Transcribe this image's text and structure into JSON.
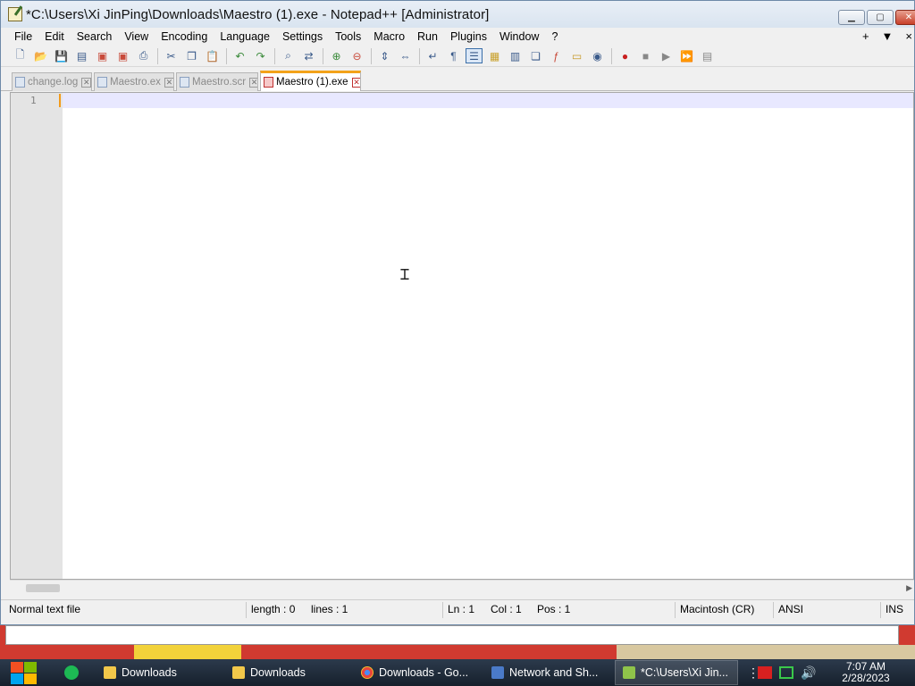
{
  "window": {
    "title": "*C:\\Users\\Xi JinPing\\Downloads\\Maestro (1).exe - Notepad++ [Administrator]"
  },
  "menu": {
    "items": [
      "File",
      "Edit",
      "Search",
      "View",
      "Encoding",
      "Language",
      "Settings",
      "Tools",
      "Macro",
      "Run",
      "Plugins",
      "Window",
      "?"
    ],
    "right": [
      "+",
      "▼",
      "×"
    ]
  },
  "tabs": [
    {
      "label": "change.log",
      "active": false
    },
    {
      "label": "Maestro.ex",
      "active": false
    },
    {
      "label": "Maestro.scr",
      "active": false
    },
    {
      "label": "Maestro (1).exe",
      "active": true
    }
  ],
  "editor": {
    "line_number": "1",
    "content": ""
  },
  "status": {
    "file_type": "Normal text file",
    "length": "length : 0",
    "lines": "lines : 1",
    "ln": "Ln : 1",
    "col": "Col : 1",
    "pos": "Pos : 1",
    "eol": "Macintosh (CR)",
    "encoding": "ANSI",
    "mode": "INS"
  },
  "taskbar": {
    "apps": [
      {
        "label": "Downloads",
        "icon": "folder-icon",
        "color": "#f2c84a"
      },
      {
        "label": "Downloads",
        "icon": "folder-icon",
        "color": "#f2c84a"
      },
      {
        "label": "Downloads - Go...",
        "icon": "chrome-icon",
        "color": "#e8453c"
      },
      {
        "label": "Network and Sh...",
        "icon": "network-icon",
        "color": "#4a7ac8"
      },
      {
        "label": "*C:\\Users\\Xi Jin...",
        "icon": "notepadpp-icon",
        "color": "#8fc34a"
      }
    ],
    "clock_time": "7:07 AM",
    "clock_date": "2/28/2023"
  },
  "colors": {
    "tab_accent": "#f3a21a",
    "current_line": "#e8e8ff",
    "taskbar": "#1e2a38"
  }
}
